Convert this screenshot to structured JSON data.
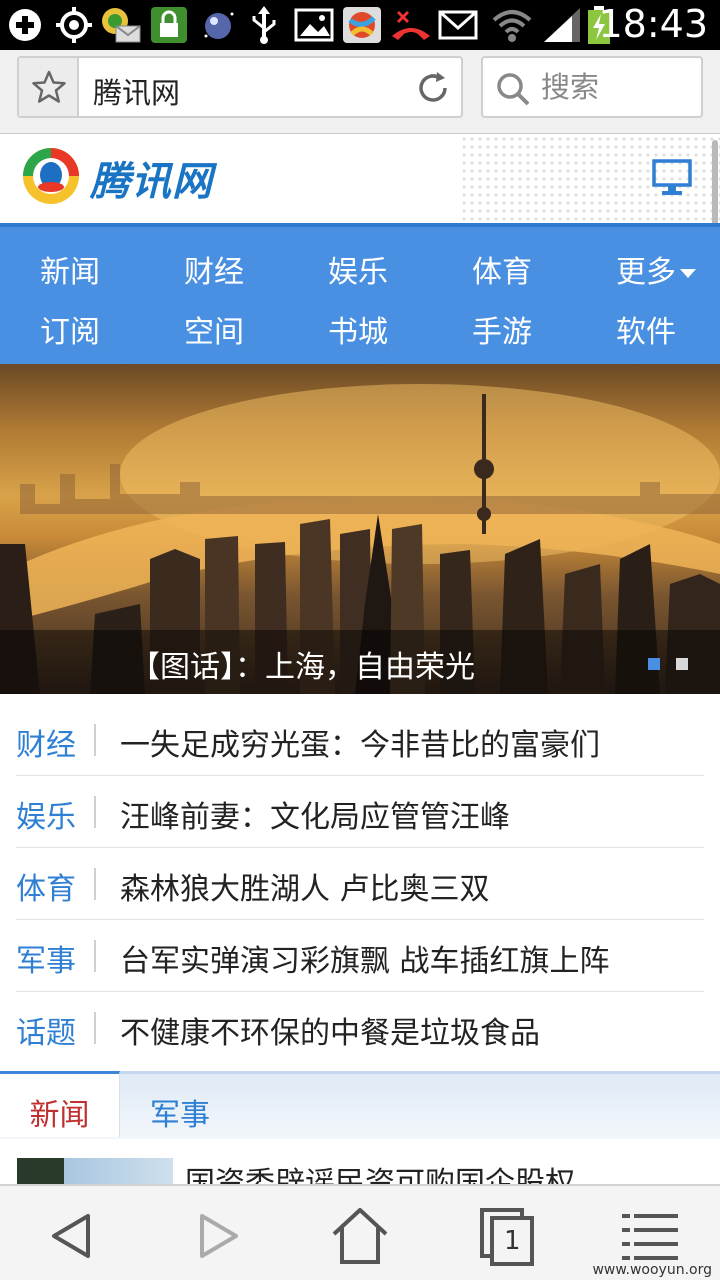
{
  "status_bar": {
    "time": "18:43",
    "icons": [
      "add-icon",
      "gps-icon",
      "app-mail-icon",
      "lock-icon",
      "weather-icon",
      "usb-icon",
      "image-icon",
      "app-ball-icon",
      "missed-call-icon",
      "mail-icon",
      "wifi-icon",
      "signal-icon",
      "battery-charging-icon"
    ]
  },
  "browser": {
    "url": "腾讯网",
    "search_placeholder": "搜索"
  },
  "site": {
    "logo_text": "腾讯网"
  },
  "nav": {
    "row1": [
      "新闻",
      "财经",
      "娱乐",
      "体育",
      "更多"
    ],
    "row2": [
      "订阅",
      "空间",
      "书城",
      "手游",
      "软件"
    ]
  },
  "hero": {
    "caption": "【图话】：上海，自由荣光",
    "slide_count": 2,
    "active_slide": 1
  },
  "headlines": [
    {
      "category": "财经",
      "title": "一失足成穷光蛋：今非昔比的富豪们"
    },
    {
      "category": "娱乐",
      "title": "汪峰前妻：文化局应管管汪峰"
    },
    {
      "category": "体育",
      "title": "森林狼大胜湖人 卢比奥三双"
    },
    {
      "category": "军事",
      "title": "台军实弹演习彩旗飘 战车插红旗上阵"
    },
    {
      "category": "话题",
      "title": "不健康不环保的中餐是垃圾食品"
    }
  ],
  "tabs": {
    "active": "新闻",
    "inactive": "军事"
  },
  "news": {
    "first_title": "国资委辟谣民资可购国企股权"
  },
  "toolbar": {
    "tab_count": "1"
  },
  "watermark": "www.wooyun.org",
  "colors": {
    "nav_bg": "#4a90e2",
    "category_blue": "#2f7fd3",
    "active_tab_red": "#c03030"
  }
}
